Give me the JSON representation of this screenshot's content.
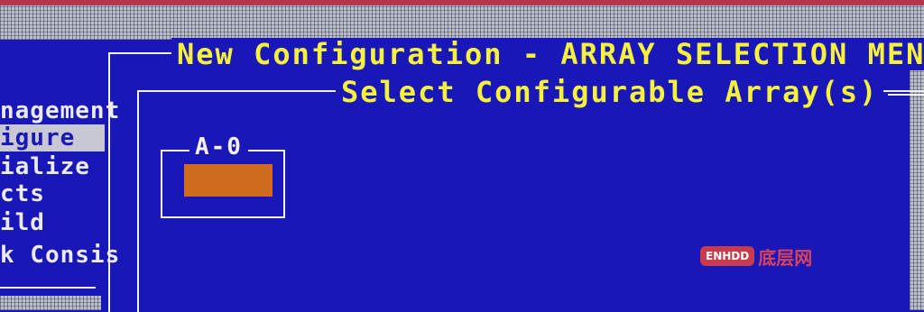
{
  "main_menu": {
    "items": [
      {
        "label": "nagement",
        "selected": false
      },
      {
        "label": "igure",
        "selected": true
      },
      {
        "label": "ialize",
        "selected": false
      },
      {
        "label": "cts",
        "selected": false
      },
      {
        "label": "ild",
        "selected": false
      },
      {
        "label": "k Consis",
        "selected": false
      }
    ]
  },
  "window": {
    "title": "New Configuration - ARRAY SELECTION MENU-"
  },
  "subwindow": {
    "title": "Select Configurable Array(s)"
  },
  "arrays": [
    {
      "label": "A-0",
      "status_color": "#d06a1e"
    }
  ],
  "watermark": {
    "badge": "ENHDD",
    "text": "底层网"
  },
  "colors": {
    "background": "#1a17b8",
    "title_text": "#f6f23c",
    "menu_text": "#e9eaf2",
    "selected_bg": "#c7c8d4",
    "array_fill": "#d06a1e"
  }
}
